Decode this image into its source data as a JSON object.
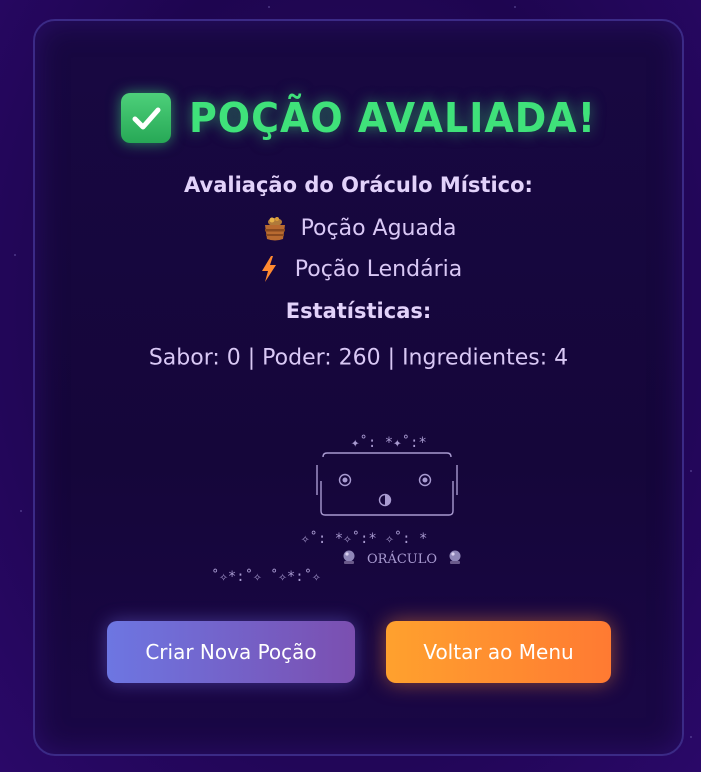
{
  "title": "POÇÃO AVALIADA!",
  "subtitle": "Avaliação do Oráculo Místico:",
  "results": [
    {
      "icon": "pot-icon",
      "label": "Poção Aguada"
    },
    {
      "icon": "lightning-icon",
      "label": "Poção Lendária"
    }
  ],
  "stats_title": "Estatísticas:",
  "stats_line": "Sabor: 0 | Poder: 260 | Ingredientes: 4",
  "oracle_art": {
    "top_sparkles": "✦˚: *✦˚:*",
    "bottom_sparkles": "✧˚: *✧˚:* ✧˚: *",
    "caption": "ORÁCULO",
    "footer_sparkles": "˚✧*:˚✧ ˚✧*:˚✧"
  },
  "buttons": {
    "new_potion": "Criar Nova Poção",
    "back_menu": "Voltar ao Menu"
  },
  "colors": {
    "accent_green": "#3fe27a",
    "button_new_start": "#6d76e2",
    "button_new_end": "#7b4fb0",
    "button_menu_start": "#ffa12e",
    "button_menu_end": "#ff7a32"
  }
}
